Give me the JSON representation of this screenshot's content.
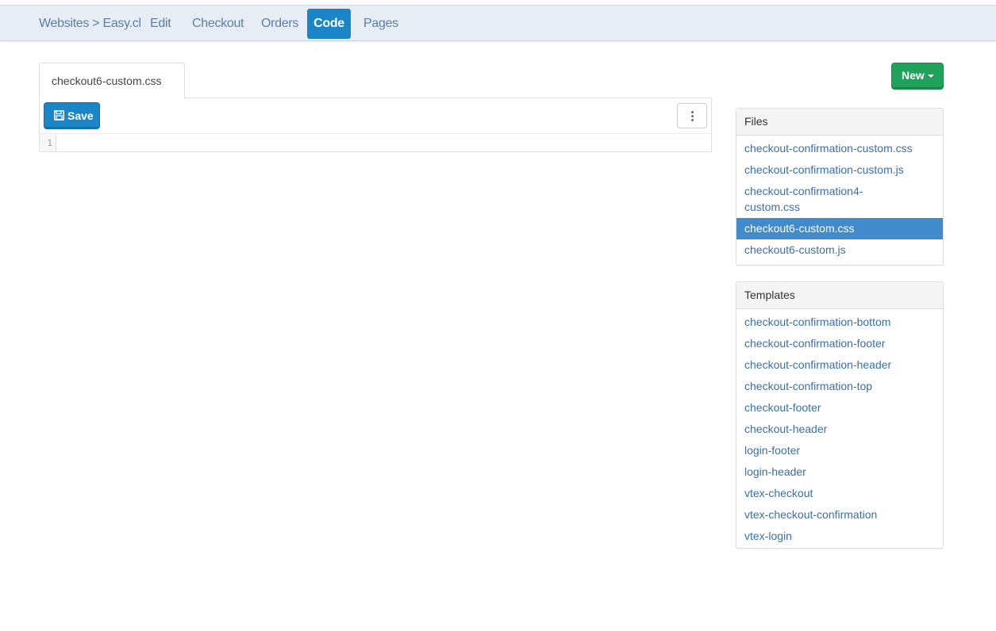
{
  "nav": {
    "breadcrumb": "Websites > Easy.cl",
    "items": [
      "Edit",
      "Checkout",
      "Orders",
      "Code",
      "Pages"
    ],
    "active": "Code"
  },
  "editor": {
    "file_tab": "checkout6-custom.css",
    "save_label": "Save",
    "line_numbers": [
      "1"
    ]
  },
  "new_button": {
    "label": "New"
  },
  "files": {
    "title": "Files",
    "items": [
      "checkout-confirmation-custom.css",
      "checkout-confirmation-custom.js",
      "checkout-confirmation4-custom.css",
      "checkout6-custom.css",
      "checkout6-custom.js"
    ],
    "active": "checkout6-custom.css"
  },
  "templates": {
    "title": "Templates",
    "items": [
      "checkout-confirmation-bottom",
      "checkout-confirmation-footer",
      "checkout-confirmation-header",
      "checkout-confirmation-top",
      "checkout-footer",
      "checkout-header",
      "login-footer",
      "login-header",
      "vtex-checkout",
      "vtex-checkout-confirmation",
      "vtex-login"
    ]
  },
  "colors": {
    "nav_bg": "#e6edf5",
    "nav_link": "#5b7fa5",
    "primary": "#1a86c8",
    "success": "#21a25a",
    "link": "#3a6fa8",
    "list_active": "#428bca"
  }
}
